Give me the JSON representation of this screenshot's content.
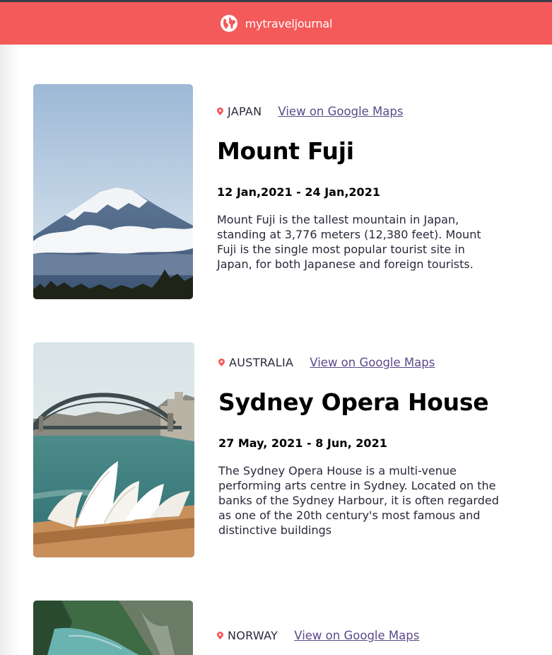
{
  "header": {
    "brand": "mytraveljournal",
    "icon": "globe-icon",
    "color": "#f55a5a"
  },
  "entries": [
    {
      "country": "JAPAN",
      "map_link": "View on Google Maps",
      "title": "Mount Fuji",
      "dates": "12 Jan,2021 - 24 Jan,2021",
      "description": "Mount Fuji is the tallest mountain in Japan, standing at 3,776 meters (12,380 feet). Mount Fuji is the single most popular tourist site in Japan, for both Japanese and foreign tourists."
    },
    {
      "country": "AUSTRALIA",
      "map_link": "View on Google Maps",
      "title": "Sydney Opera House",
      "dates": "27 May, 2021 - 8 Jun, 2021",
      "description": "The Sydney Opera House is a multi-venue performing arts centre in Sydney. Located on the banks of the Sydney Harbour, it is often regarded as one of the 20th century's most famous and distinctive buildings"
    },
    {
      "country": "NORWAY",
      "map_link": "View on Google Maps"
    }
  ]
}
